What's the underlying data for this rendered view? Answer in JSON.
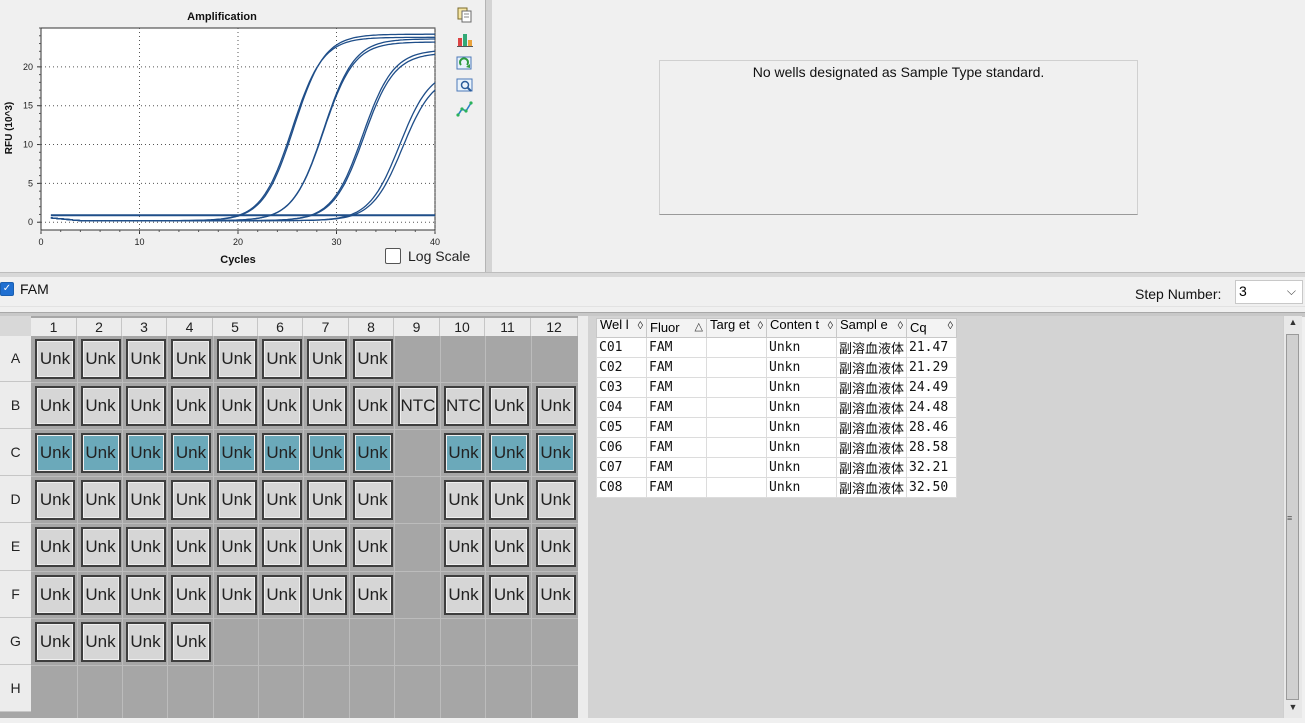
{
  "chart": {
    "title": "Amplification",
    "xlabel": "Cycles",
    "ylabel": "RFU (10^3)",
    "log_scale_label": "Log Scale",
    "log_scale_checked": false
  },
  "chart_data": {
    "type": "line",
    "title": "Amplification",
    "xlabel": "Cycles",
    "ylabel": "RFU (10^3)",
    "xlim": [
      0,
      40
    ],
    "ylim": [
      -1,
      25
    ],
    "xticks": [
      0,
      10,
      20,
      30,
      40
    ],
    "yticks": [
      0,
      5,
      10,
      15,
      20
    ],
    "grid": true,
    "line_color": "#1f4e89",
    "baseline": {
      "x": [
        1,
        40
      ],
      "y": [
        0.9,
        0.9
      ]
    },
    "curves": [
      {
        "well": "C01",
        "cq": 21.47,
        "plateau": 24.0
      },
      {
        "well": "C02",
        "cq": 21.29,
        "plateau": 23.6
      },
      {
        "well": "C03",
        "cq": 24.49,
        "plateau": 23.4
      },
      {
        "well": "C04",
        "cq": 24.48,
        "plateau": 23.0
      },
      {
        "well": "C05",
        "cq": 28.46,
        "plateau": 22.0
      },
      {
        "well": "C06",
        "cq": 28.58,
        "plateau": 21.6
      },
      {
        "well": "C07",
        "cq": 32.21,
        "plateau": 19.5
      },
      {
        "well": "C08",
        "cq": 32.5,
        "plateau": 18.8
      }
    ]
  },
  "toolbar": {
    "icons": [
      "copy-icon",
      "export-icon",
      "refresh-icon",
      "zoom-icon",
      "chart-settings-icon"
    ]
  },
  "standard_curve": {
    "message": "No wells designated as Sample Type standard."
  },
  "fluor_filter": {
    "label": "FAM",
    "checked": true
  },
  "step": {
    "label": "Step Number:",
    "value": "3"
  },
  "plate": {
    "columns": [
      "1",
      "2",
      "3",
      "4",
      "5",
      "6",
      "7",
      "8",
      "9",
      "10",
      "11",
      "12"
    ],
    "rows": [
      "A",
      "B",
      "C",
      "D",
      "E",
      "F",
      "G",
      "H"
    ],
    "wells": {
      "A": [
        "Unk",
        "Unk",
        "Unk",
        "Unk",
        "Unk",
        "Unk",
        "Unk",
        "Unk",
        "",
        "",
        "",
        ""
      ],
      "B": [
        "Unk",
        "Unk",
        "Unk",
        "Unk",
        "Unk",
        "Unk",
        "Unk",
        "Unk",
        "NTC",
        "NTC",
        "Unk",
        "Unk"
      ],
      "C": [
        "Unk",
        "Unk",
        "Unk",
        "Unk",
        "Unk",
        "Unk",
        "Unk",
        "Unk",
        "",
        "Unk",
        "Unk",
        "Unk"
      ],
      "D": [
        "Unk",
        "Unk",
        "Unk",
        "Unk",
        "Unk",
        "Unk",
        "Unk",
        "Unk",
        "",
        "Unk",
        "Unk",
        "Unk"
      ],
      "E": [
        "Unk",
        "Unk",
        "Unk",
        "Unk",
        "Unk",
        "Unk",
        "Unk",
        "Unk",
        "",
        "Unk",
        "Unk",
        "Unk"
      ],
      "F": [
        "Unk",
        "Unk",
        "Unk",
        "Unk",
        "Unk",
        "Unk",
        "Unk",
        "Unk",
        "",
        "Unk",
        "Unk",
        "Unk"
      ],
      "G": [
        "Unk",
        "Unk",
        "Unk",
        "Unk",
        "",
        "",
        "",
        "",
        "",
        "",
        "",
        ""
      ],
      "H": [
        "",
        "",
        "",
        "",
        "",
        "",
        "",
        "",
        "",
        "",
        "",
        ""
      ]
    },
    "selected_row": "C",
    "selected_color": "#6ba9ba"
  },
  "table": {
    "headers": [
      "Wel\nl",
      "Fluor",
      "Targ\net",
      "Conten\nt",
      "Sampl\ne",
      "Cq"
    ],
    "rows": [
      [
        "C01",
        "FAM",
        "",
        "Unkn",
        "副溶血液体",
        "21.47"
      ],
      [
        "C02",
        "FAM",
        "",
        "Unkn",
        "副溶血液体",
        "21.29"
      ],
      [
        "C03",
        "FAM",
        "",
        "Unkn",
        "副溶血液体",
        "24.49"
      ],
      [
        "C04",
        "FAM",
        "",
        "Unkn",
        "副溶血液体",
        "24.48"
      ],
      [
        "C05",
        "FAM",
        "",
        "Unkn",
        "副溶血液体",
        "28.46"
      ],
      [
        "C06",
        "FAM",
        "",
        "Unkn",
        "副溶血液体",
        "28.58"
      ],
      [
        "C07",
        "FAM",
        "",
        "Unkn",
        "副溶血液体",
        "32.21"
      ],
      [
        "C08",
        "FAM",
        "",
        "Unkn",
        "副溶血液体",
        "32.50"
      ]
    ]
  }
}
